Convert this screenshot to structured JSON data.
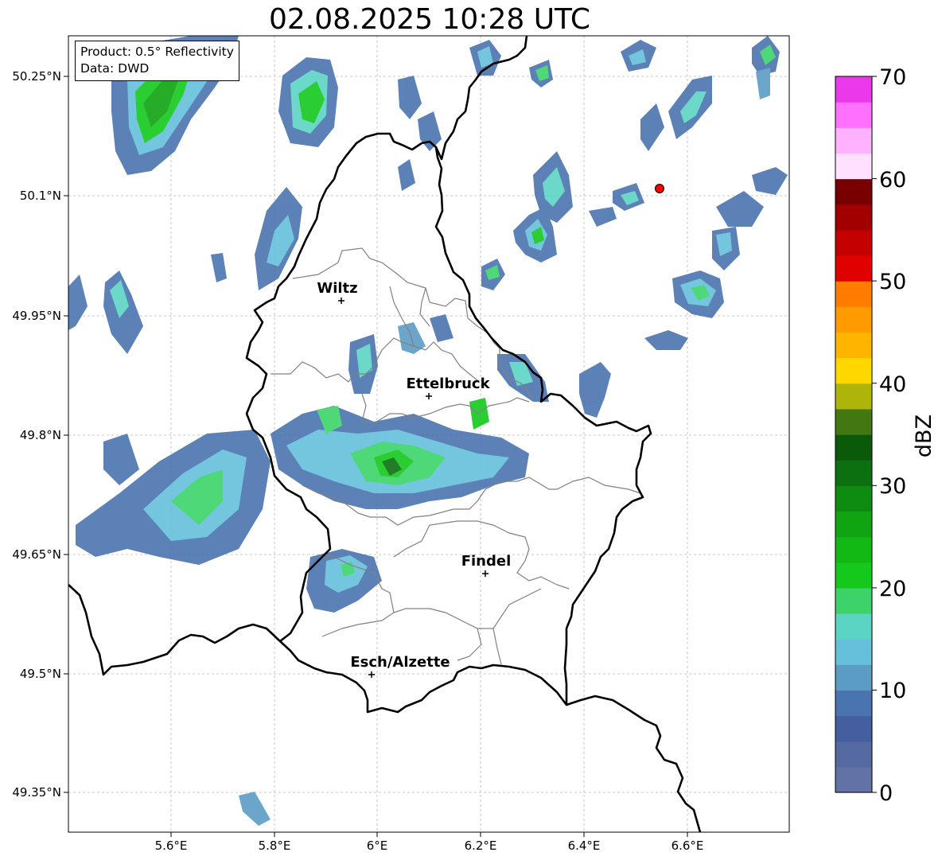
{
  "title": "02.08.2025 10:28 UTC",
  "info": {
    "product": "Product: 0.5° Reflectivity",
    "data": "Data: DWD"
  },
  "lat_ticks": [
    "50.25°N",
    "50.1°N",
    "49.95°N",
    "49.8°N",
    "49.65°N",
    "49.5°N",
    "49.35°N"
  ],
  "lon_ticks": [
    "5.6°E",
    "5.8°E",
    "6°E",
    "6.2°E",
    "6.4°E",
    "6.6°E"
  ],
  "places": [
    {
      "name": "Wiltz"
    },
    {
      "name": "Ettelbruck"
    },
    {
      "name": "Findel"
    },
    {
      "name": "Esch/Alzette"
    }
  ],
  "colorbar": {
    "label": "dBZ",
    "ticks": [
      "0",
      "10",
      "20",
      "30",
      "40",
      "50",
      "60",
      "70"
    ],
    "colors": [
      "#6272a6",
      "#556aa0",
      "#445ea0",
      "#4a74b0",
      "#5b9cc4",
      "#66c0dc",
      "#5cd4c4",
      "#3cd46a",
      "#14c81c",
      "#12b814",
      "#10a412",
      "#0e8c10",
      "#0c7010",
      "#0a5a0a",
      "#437712",
      "#aeb40a",
      "#ffd700",
      "#ffb400",
      "#ff9a00",
      "#ff7c00",
      "#e00000",
      "#c40000",
      "#a20000",
      "#780000",
      "#ffe0ff",
      "#ffb2ff",
      "#ff70ff",
      "#ea38ea"
    ]
  },
  "marker": {
    "color": "#ff0000"
  }
}
